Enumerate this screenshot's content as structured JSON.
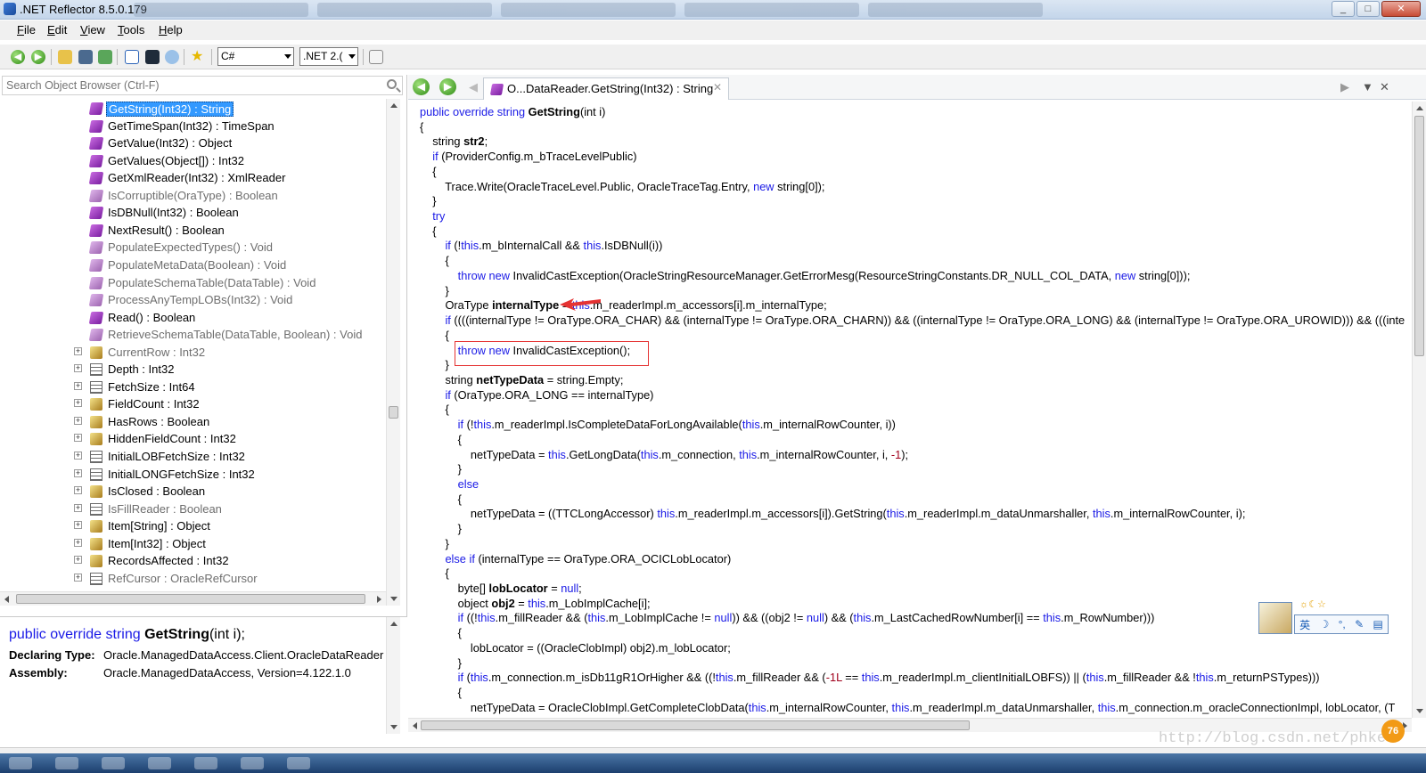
{
  "window": {
    "title": ".NET Reflector 8.5.0.179",
    "buttons": [
      "_",
      "□",
      "✕"
    ]
  },
  "menu": [
    "File",
    "Edit",
    "View",
    "Tools",
    "Help"
  ],
  "toolbar": {
    "language": "C#",
    "framework": ".NET 2.("
  },
  "search": {
    "placeholder": "Search Object Browser (Ctrl-F)"
  },
  "tree": [
    {
      "label": "GetString(Int32) : String",
      "icon": "method-icon",
      "expander": "",
      "dim": false,
      "selected": true
    },
    {
      "label": "GetTimeSpan(Int32) : TimeSpan",
      "icon": "method-icon",
      "expander": "",
      "dim": false
    },
    {
      "label": "GetValue(Int32) : Object",
      "icon": "method-icon",
      "expander": "",
      "dim": false
    },
    {
      "label": "GetValues(Object[]) : Int32",
      "icon": "method-icon",
      "expander": "",
      "dim": false
    },
    {
      "label": "GetXmlReader(Int32) : XmlReader",
      "icon": "method-icon",
      "expander": "",
      "dim": false
    },
    {
      "label": "IsCorruptible(OraType) : Boolean",
      "icon": "method-protected-icon",
      "expander": "",
      "dim": true
    },
    {
      "label": "IsDBNull(Int32) : Boolean",
      "icon": "method-icon",
      "expander": "",
      "dim": false
    },
    {
      "label": "NextResult() : Boolean",
      "icon": "method-icon",
      "expander": "",
      "dim": false
    },
    {
      "label": "PopulateExpectedTypes() : Void",
      "icon": "method-protected-icon",
      "expander": "",
      "dim": true
    },
    {
      "label": "PopulateMetaData(Boolean) : Void",
      "icon": "method-protected-icon",
      "expander": "",
      "dim": true
    },
    {
      "label": "PopulateSchemaTable(DataTable) : Void",
      "icon": "method-protected-icon",
      "expander": "",
      "dim": true
    },
    {
      "label": "ProcessAnyTempLOBs(Int32) : Void",
      "icon": "method-protected-icon",
      "expander": "",
      "dim": true
    },
    {
      "label": "Read() : Boolean",
      "icon": "method-icon",
      "expander": "",
      "dim": false
    },
    {
      "label": "RetrieveSchemaTable(DataTable, Boolean) : Void",
      "icon": "method-protected-icon",
      "expander": "",
      "dim": true
    },
    {
      "label": "CurrentRow : Int32",
      "icon": "property-icon",
      "expander": "+",
      "dim": true
    },
    {
      "label": "Depth : Int32",
      "icon": "property-list-icon",
      "expander": "+",
      "dim": false
    },
    {
      "label": "FetchSize : Int64",
      "icon": "property-list-icon",
      "expander": "+",
      "dim": false
    },
    {
      "label": "FieldCount : Int32",
      "icon": "property-icon",
      "expander": "+",
      "dim": false
    },
    {
      "label": "HasRows : Boolean",
      "icon": "property-icon",
      "expander": "+",
      "dim": false
    },
    {
      "label": "HiddenFieldCount : Int32",
      "icon": "property-icon",
      "expander": "+",
      "dim": false
    },
    {
      "label": "InitialLOBFetchSize : Int32",
      "icon": "property-list-icon",
      "expander": "+",
      "dim": false
    },
    {
      "label": "InitialLONGFetchSize : Int32",
      "icon": "property-list-icon",
      "expander": "+",
      "dim": false
    },
    {
      "label": "IsClosed : Boolean",
      "icon": "property-icon",
      "expander": "+",
      "dim": false
    },
    {
      "label": "IsFillReader : Boolean",
      "icon": "property-list-icon",
      "expander": "+",
      "dim": true
    },
    {
      "label": "Item[String] : Object",
      "icon": "property-icon",
      "expander": "+",
      "dim": false
    },
    {
      "label": "Item[Int32] : Object",
      "icon": "property-icon",
      "expander": "+",
      "dim": false
    },
    {
      "label": "RecordsAffected : Int32",
      "icon": "property-icon",
      "expander": "+",
      "dim": false
    },
    {
      "label": "RefCursor : OracleRefCursor",
      "icon": "property-list-icon",
      "expander": "+",
      "dim": true
    }
  ],
  "info": {
    "signature_kw": "public override string ",
    "signature_name": "GetString",
    "signature_args": "(int i);",
    "declaring_label": "Declaring Type:",
    "declaring_value": "Oracle.ManagedDataAccess.Client.OracleDataReader",
    "assembly_label": "Assembly:",
    "assembly_value": "Oracle.ManagedDataAccess, Version=4.122.1.0"
  },
  "doc_tab": {
    "title": "O...DataReader.GetString(Int32) : String"
  },
  "code_lines": [
    [
      [
        "k",
        "public override string "
      ],
      [
        "d",
        "GetString"
      ],
      [
        "p",
        "(int i)"
      ]
    ],
    [
      [
        "p",
        "{"
      ]
    ],
    [
      [
        "p",
        "    string "
      ],
      [
        "d",
        "str2"
      ],
      [
        "p",
        ";"
      ]
    ],
    [
      [
        "k",
        "    if "
      ],
      [
        "p",
        "(ProviderConfig.m_bTraceLevelPublic)"
      ]
    ],
    [
      [
        "p",
        "    {"
      ]
    ],
    [
      [
        "p",
        "        Trace.Write(OracleTraceLevel.Public, OracleTraceTag.Entry, "
      ],
      [
        "k",
        "new "
      ],
      [
        "p",
        "string[0]);"
      ]
    ],
    [
      [
        "p",
        "    }"
      ]
    ],
    [
      [
        "k",
        "    try"
      ]
    ],
    [
      [
        "p",
        "    {"
      ]
    ],
    [
      [
        "k",
        "        if "
      ],
      [
        "p",
        "(!"
      ],
      [
        "k",
        "this"
      ],
      [
        "p",
        ".m_bInternalCall && "
      ],
      [
        "k",
        "this"
      ],
      [
        "p",
        ".IsDBNull(i))"
      ]
    ],
    [
      [
        "p",
        "        {"
      ]
    ],
    [
      [
        "k",
        "            throw new "
      ],
      [
        "p",
        "InvalidCastException(OracleStringResourceManager.GetErrorMesg(ResourceStringConstants.DR_NULL_COL_DATA, "
      ],
      [
        "k",
        "new "
      ],
      [
        "p",
        "string[0]));"
      ]
    ],
    [
      [
        "p",
        "        }"
      ]
    ],
    [
      [
        "p",
        "        OraType "
      ],
      [
        "d",
        "internalType"
      ],
      [
        "p",
        " = "
      ],
      [
        "k",
        "this"
      ],
      [
        "p",
        ".m_readerImpl.m_accessors[i].m_internalType;"
      ]
    ],
    [
      [
        "k",
        "        if "
      ],
      [
        "p",
        "((((internalType != OraType.ORA_CHAR) && (internalType != OraType.ORA_CHARN)) && ((internalType != OraType.ORA_LONG) && (internalType != OraType.ORA_UROWID))) && (((inte"
      ]
    ],
    [
      [
        "p",
        "        {"
      ]
    ],
    [
      [
        "k",
        "            throw new "
      ],
      [
        "p",
        "InvalidCastException();"
      ]
    ],
    [
      [
        "p",
        "        }"
      ]
    ],
    [
      [
        "p",
        "        string "
      ],
      [
        "d",
        "netTypeData"
      ],
      [
        "p",
        " = string.Empty;"
      ]
    ],
    [
      [
        "k",
        "        if "
      ],
      [
        "p",
        "(OraType.ORA_LONG == internalType)"
      ]
    ],
    [
      [
        "p",
        "        {"
      ]
    ],
    [
      [
        "k",
        "            if "
      ],
      [
        "p",
        "(!"
      ],
      [
        "k",
        "this"
      ],
      [
        "p",
        ".m_readerImpl.IsCompleteDataForLongAvailable("
      ],
      [
        "k",
        "this"
      ],
      [
        "p",
        ".m_internalRowCounter, i))"
      ]
    ],
    [
      [
        "p",
        "            {"
      ]
    ],
    [
      [
        "p",
        "                netTypeData = "
      ],
      [
        "k",
        "this"
      ],
      [
        "p",
        ".GetLongData("
      ],
      [
        "k",
        "this"
      ],
      [
        "p",
        ".m_connection, "
      ],
      [
        "k",
        "this"
      ],
      [
        "p",
        ".m_internalRowCounter, i, "
      ],
      [
        "n",
        "-1"
      ],
      [
        "p",
        ");"
      ]
    ],
    [
      [
        "p",
        "            }"
      ]
    ],
    [
      [
        "k",
        "            else"
      ]
    ],
    [
      [
        "p",
        "            {"
      ]
    ],
    [
      [
        "p",
        "                netTypeData = ((TTCLongAccessor) "
      ],
      [
        "k",
        "this"
      ],
      [
        "p",
        ".m_readerImpl.m_accessors[i]).GetString("
      ],
      [
        "k",
        "this"
      ],
      [
        "p",
        ".m_readerImpl.m_dataUnmarshaller, "
      ],
      [
        "k",
        "this"
      ],
      [
        "p",
        ".m_internalRowCounter, i);"
      ]
    ],
    [
      [
        "p",
        "            }"
      ]
    ],
    [
      [
        "p",
        "        }"
      ]
    ],
    [
      [
        "k",
        "        else if "
      ],
      [
        "p",
        "(internalType == OraType.ORA_OCICLobLocator)"
      ]
    ],
    [
      [
        "p",
        "        {"
      ]
    ],
    [
      [
        "p",
        "            byte[] "
      ],
      [
        "d",
        "lobLocator"
      ],
      [
        "p",
        " = "
      ],
      [
        "k",
        "null"
      ],
      [
        "p",
        ";"
      ]
    ],
    [
      [
        "p",
        "            object "
      ],
      [
        "d",
        "obj2"
      ],
      [
        "p",
        " = "
      ],
      [
        "k",
        "this"
      ],
      [
        "p",
        ".m_LobImplCache[i];"
      ]
    ],
    [
      [
        "k",
        "            if "
      ],
      [
        "p",
        "((!"
      ],
      [
        "k",
        "this"
      ],
      [
        "p",
        ".m_fillReader && ("
      ],
      [
        "k",
        "this"
      ],
      [
        "p",
        ".m_LobImplCache != "
      ],
      [
        "k",
        "null"
      ],
      [
        "p",
        ")) && ((obj2 != "
      ],
      [
        "k",
        "null"
      ],
      [
        "p",
        ") && ("
      ],
      [
        "k",
        "this"
      ],
      [
        "p",
        ".m_LastCachedRowNumber[i] == "
      ],
      [
        "k",
        "this"
      ],
      [
        "p",
        ".m_RowNumber)))"
      ]
    ],
    [
      [
        "p",
        "            {"
      ]
    ],
    [
      [
        "p",
        "                lobLocator = ((OracleClobImpl) obj2).m_lobLocator;"
      ]
    ],
    [
      [
        "p",
        "            }"
      ]
    ],
    [
      [
        "k",
        "            if "
      ],
      [
        "p",
        "("
      ],
      [
        "k",
        "this"
      ],
      [
        "p",
        ".m_connection.m_isDb11gR1OrHigher && ((!"
      ],
      [
        "k",
        "this"
      ],
      [
        "p",
        ".m_fillReader && ("
      ],
      [
        "n",
        "-1L"
      ],
      [
        "p",
        " == "
      ],
      [
        "k",
        "this"
      ],
      [
        "p",
        ".m_readerImpl.m_clientInitialLOBFS)) || ("
      ],
      [
        "k",
        "this"
      ],
      [
        "p",
        ".m_fillReader && !"
      ],
      [
        "k",
        "this"
      ],
      [
        "p",
        ".m_returnPSTypes)))"
      ]
    ],
    [
      [
        "p",
        "            {"
      ]
    ],
    [
      [
        "p",
        "                netTypeData = OracleClobImpl.GetCompleteClobData("
      ],
      [
        "k",
        "this"
      ],
      [
        "p",
        ".m_internalRowCounter, "
      ],
      [
        "k",
        "this"
      ],
      [
        "p",
        ".m_readerImpl.m_dataUnmarshaller, "
      ],
      [
        "k",
        "this"
      ],
      [
        "p",
        ".m_connection.m_oracleConnectionImpl, lobLocator, (T"
      ]
    ]
  ],
  "ime": {
    "top": "☼☾☆",
    "keys": [
      "英",
      "☽",
      "°,",
      "✎",
      "▤"
    ]
  },
  "watermark": "http://blog.csdn.net/phke",
  "badge": "76"
}
